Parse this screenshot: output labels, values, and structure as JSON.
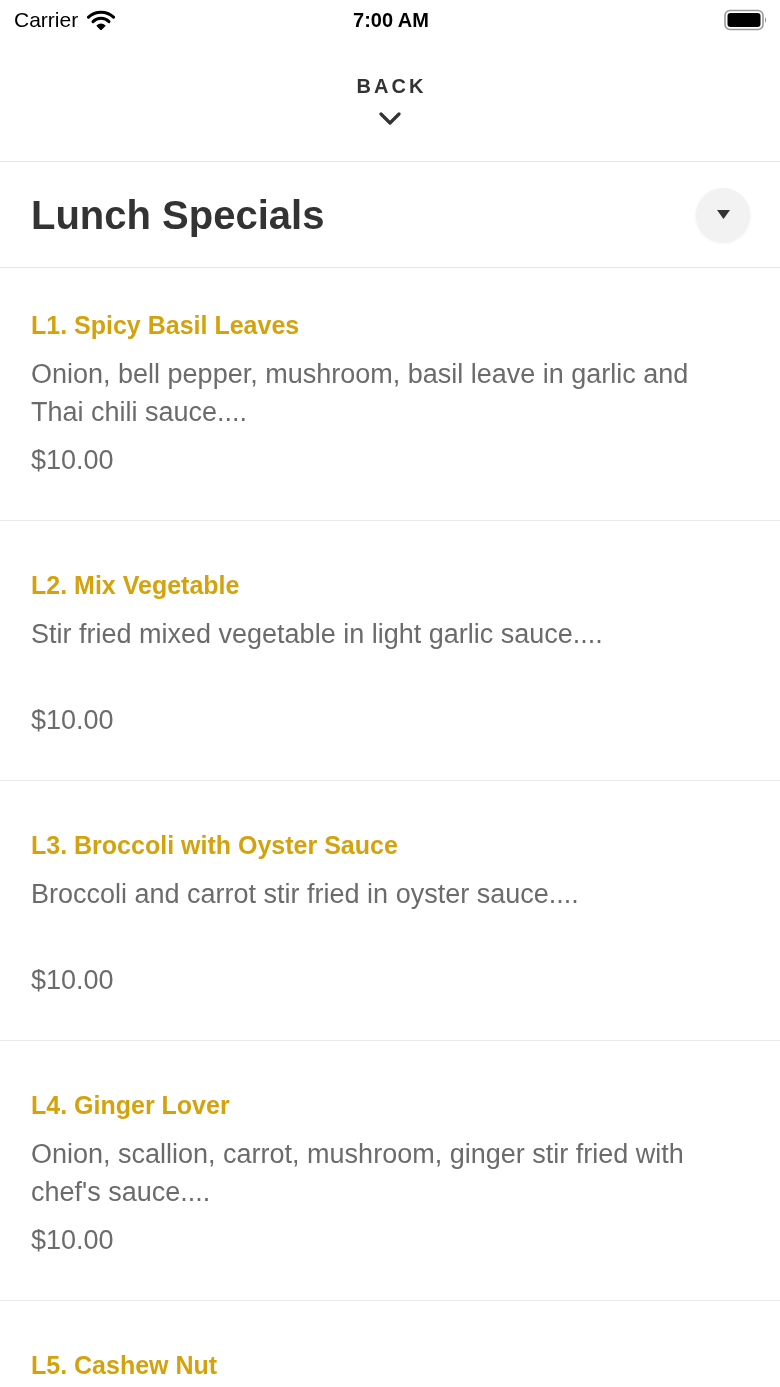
{
  "status_bar": {
    "carrier": "Carrier",
    "time": "7:00 AM"
  },
  "back": {
    "label": "BACK"
  },
  "section": {
    "title": "Lunch Specials"
  },
  "items": [
    {
      "name": "L1. Spicy Basil Leaves",
      "description": "Onion, bell pepper, mushroom, basil leave in garlic and Thai chili sauce....",
      "price": "$10.00"
    },
    {
      "name": "L2. Mix Vegetable",
      "description": "Stir fried mixed vegetable in light garlic sauce....",
      "price": "$10.00"
    },
    {
      "name": "L3. Broccoli with Oyster Sauce",
      "description": "Broccoli and carrot stir fried in oyster sauce....",
      "price": "$10.00"
    },
    {
      "name": "L4. Ginger Lover",
      "description": "Onion, scallion, carrot, mushroom, ginger stir fried with chef's sauce....",
      "price": "$10.00"
    },
    {
      "name": "L5. Cashew Nut"
    }
  ]
}
